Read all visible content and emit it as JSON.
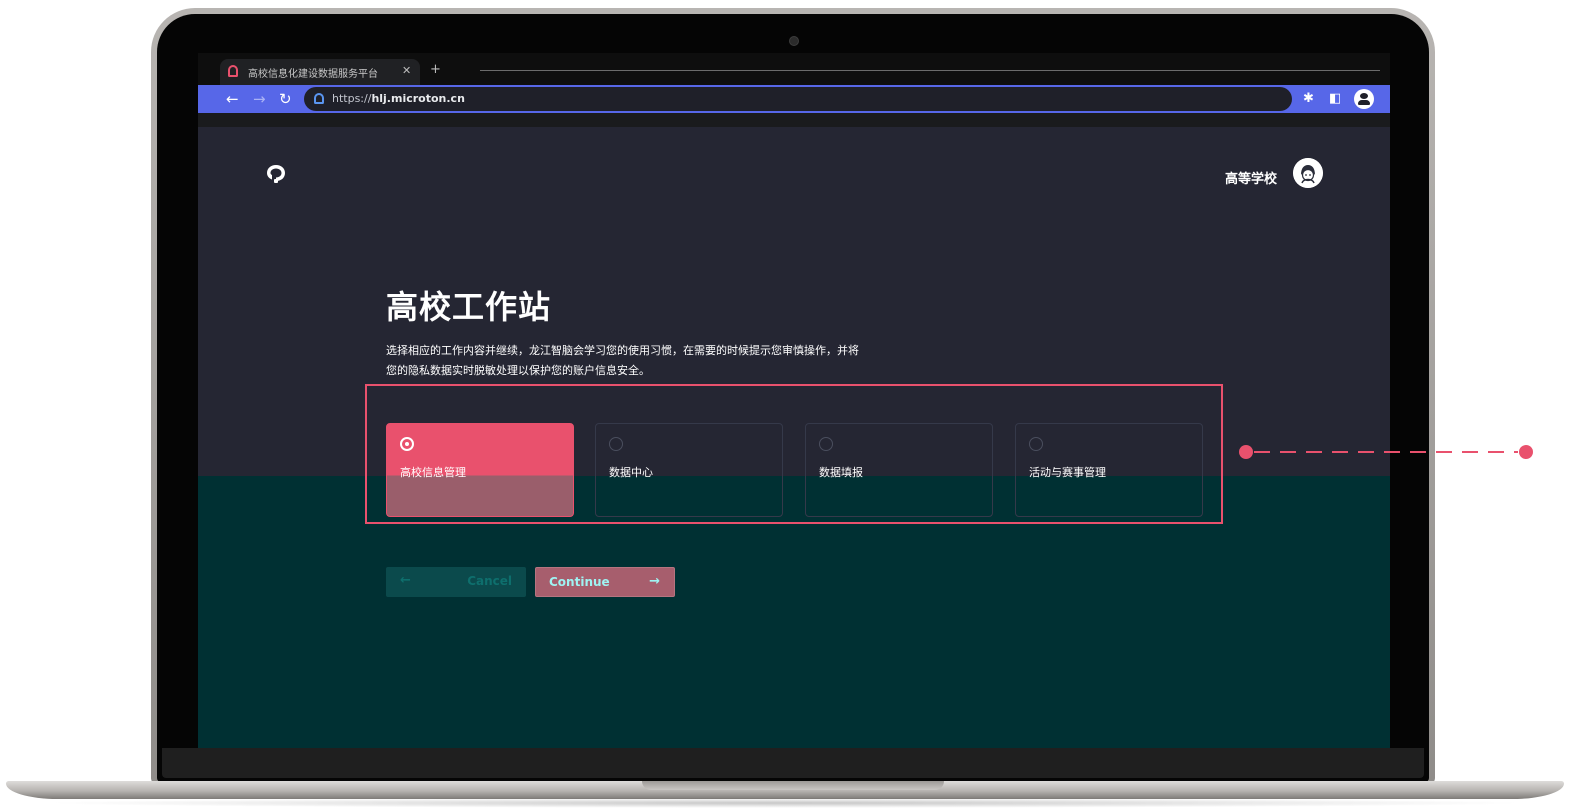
{
  "browser": {
    "tab": {
      "title": "高校信息化建设数据服务平台",
      "close_icon": "close-icon",
      "new_tab_icon": "plus-icon"
    },
    "toolbar": {
      "back_icon": "arrow-left-icon",
      "forward_icon": "arrow-right-icon",
      "reload_icon": "reload-icon",
      "url_prefix": "https://",
      "url_host": "hlj.microton.cn",
      "extensions_icon": "puzzle-icon",
      "side_panel_icon": "side-panel-icon",
      "profile_icon": "profile-icon"
    }
  },
  "header": {
    "logo_icon": "logo-icon",
    "user_name": "高等学校",
    "avatar_icon": "avatar-icon"
  },
  "main": {
    "title": "高校工作站",
    "description_line1": "选择相应的工作内容并继续，龙江智脑会学习您的使用习惯，在需要的时候提示您审慎操作，并将",
    "description_line2": "您的隐私数据实时脱敏处理以保护您的账户信息安全。",
    "options": [
      {
        "label": "高校信息管理",
        "selected": true
      },
      {
        "label": "数据中心",
        "selected": false
      },
      {
        "label": "数据填报",
        "selected": false
      },
      {
        "label": "活动与赛事管理",
        "selected": false
      }
    ],
    "buttons": {
      "cancel_label": "Cancel",
      "cancel_icon": "arrow-left-icon",
      "continue_label": "Continue",
      "continue_icon": "arrow-right-icon"
    }
  },
  "colors": {
    "accent": "#e9516d",
    "page_background": "#252633",
    "lower_background": "#003033",
    "toolbar": "#5767e8"
  }
}
